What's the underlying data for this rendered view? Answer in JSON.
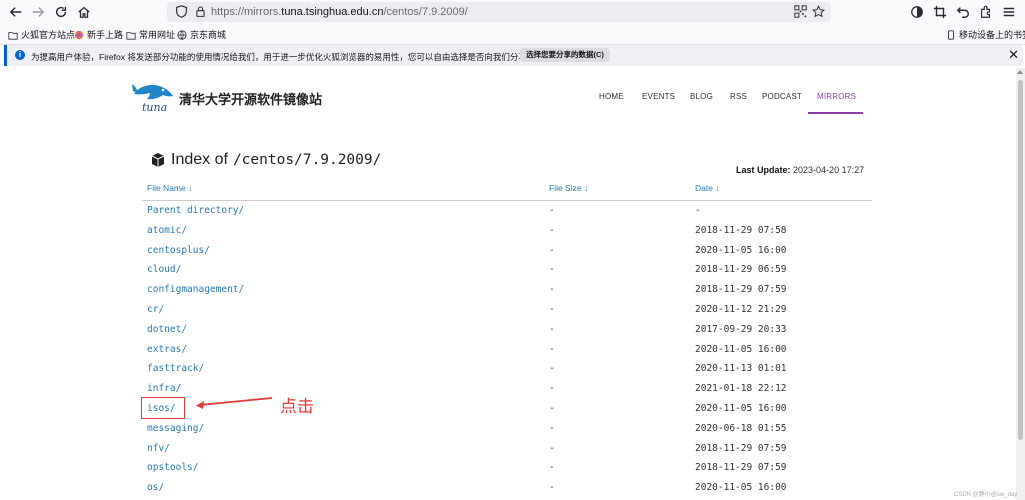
{
  "browser": {
    "url_prefix": "https://mirrors.",
    "url_domain": "tuna.tsinghua.edu.cn",
    "url_path": "/centos/7.9.2009/",
    "icons": [
      "back-icon",
      "forward-icon",
      "reload-icon",
      "home-icon",
      "shield-icon",
      "lock-icon",
      "qr-code-icon",
      "star-icon",
      "reader-mode-icon",
      "screenshot-icon",
      "undo-icon",
      "extensions-icon",
      "menu-icon"
    ]
  },
  "bookmarks": {
    "items": [
      "火狐官方站点",
      "新手上路",
      "常用网址",
      "京东商城"
    ],
    "mobile": "移动设备上的书签"
  },
  "notice": {
    "message": "为提高用户体验，Firefox 将发送部分功能的使用情况给我们，用于进一步优化火狐浏览器的易用性，您可以自由选择是否向我们分享数据。",
    "button": "选择您要分享的数据(C)"
  },
  "site": {
    "title": "清华大学开源软件镜像站",
    "logo_text": "tuna",
    "nav": [
      "HOME",
      "EVENTS",
      "BLOG",
      "RSS",
      "PODCAST",
      "MIRRORS"
    ],
    "active_nav": "MIRRORS",
    "accent": "#8b3fa8"
  },
  "index": {
    "title": "Index of",
    "path": "/centos/7.9.2009/",
    "last_update_label": "Last Update:",
    "last_update_value": "2023-04-20 17:27",
    "columns": [
      "File Name ↓",
      "File Size ↓",
      "Date ↓"
    ],
    "rows": [
      {
        "name": "Parent directory/",
        "size": "-",
        "date": "-"
      },
      {
        "name": "atomic/",
        "size": "-",
        "date": "2018-11-29 07:58"
      },
      {
        "name": "centosplus/",
        "size": "-",
        "date": "2020-11-05 16:00"
      },
      {
        "name": "cloud/",
        "size": "-",
        "date": "2018-11-29 06:59"
      },
      {
        "name": "configmanagement/",
        "size": "-",
        "date": "2018-11-29 07:59"
      },
      {
        "name": "cr/",
        "size": "-",
        "date": "2020-11-12 21:29"
      },
      {
        "name": "dotnet/",
        "size": "-",
        "date": "2017-09-29 20:33"
      },
      {
        "name": "extras/",
        "size": "-",
        "date": "2020-11-05 16:00"
      },
      {
        "name": "fasttrack/",
        "size": "-",
        "date": "2020-11-13 01:01"
      },
      {
        "name": "infra/",
        "size": "-",
        "date": "2021-01-18 22:12"
      },
      {
        "name": "isos/",
        "size": "-",
        "date": "2020-11-05 16:00"
      },
      {
        "name": "messaging/",
        "size": "-",
        "date": "2020-06-18 01:55"
      },
      {
        "name": "nfv/",
        "size": "-",
        "date": "2018-11-29 07:59"
      },
      {
        "name": "opstools/",
        "size": "-",
        "date": "2018-11-29 07:59"
      },
      {
        "name": "os/",
        "size": "-",
        "date": "2020-11-05 16:00"
      }
    ]
  },
  "annotation": {
    "text": "点击",
    "color": "#e53935"
  },
  "watermark": "CSDN @静小@sw_day"
}
